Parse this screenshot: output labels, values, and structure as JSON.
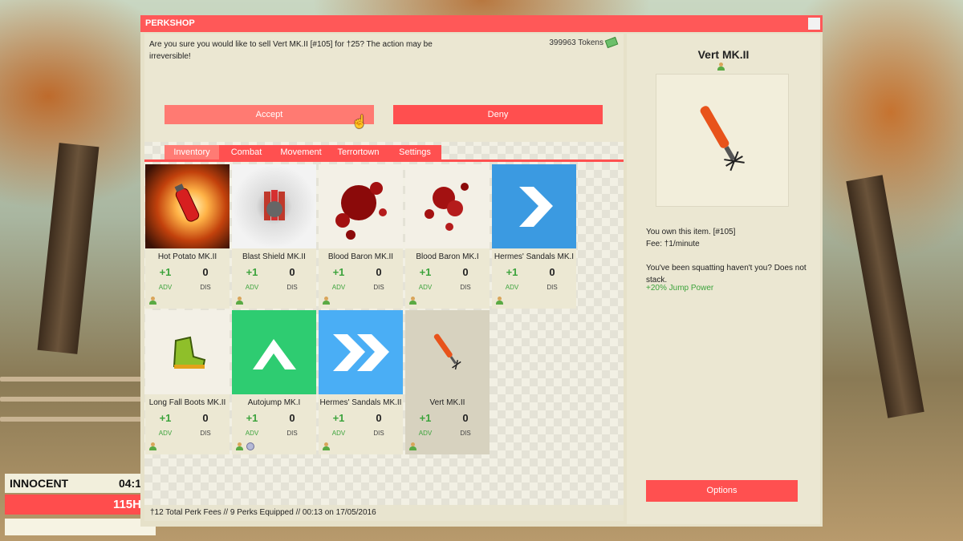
{
  "window": {
    "title": "PERKSHOP"
  },
  "confirm": {
    "message": "Are you sure you would like to sell Vert MK.II [#105] for †25? The action may be irreversible!",
    "tokens": "399963 Tokens",
    "accept_label": "Accept",
    "deny_label": "Deny"
  },
  "tabs": [
    "Inventory",
    "Combat",
    "Movement",
    "Terrortown",
    "Settings"
  ],
  "active_tab": "Inventory",
  "perks": [
    {
      "name": "Hot Potato MK.II",
      "adv": "+1",
      "dis": "0",
      "icon": "grenade-fire-icon"
    },
    {
      "name": "Blast Shield MK.II",
      "adv": "+1",
      "dis": "0",
      "icon": "dynamite-shield-icon"
    },
    {
      "name": "Blood Baron MK.II",
      "adv": "+1",
      "dis": "0",
      "icon": "blood-splatter-icon"
    },
    {
      "name": "Blood Baron MK.I",
      "adv": "+1",
      "dis": "0",
      "icon": "blood-splatter-icon"
    },
    {
      "name": "Hermes' Sandals MK.I",
      "adv": "+1",
      "dis": "0",
      "icon": "chevron-right-icon",
      "color": "#3b9ae1"
    },
    {
      "name": "Long Fall Boots MK.II",
      "adv": "+1",
      "dis": "0",
      "icon": "boot-icon"
    },
    {
      "name": "Autojump MK.I",
      "adv": "+1",
      "dis": "0",
      "icon": "chevron-up-icon",
      "color": "#2ecc71"
    },
    {
      "name": "Hermes' Sandals MK.II",
      "adv": "+1",
      "dis": "0",
      "icon": "double-chevron-right-icon",
      "color": "#4aaef5"
    },
    {
      "name": "Vert MK.II",
      "adv": "+1",
      "dis": "0",
      "icon": "rocket-icon"
    }
  ],
  "labels": {
    "adv": "ADV",
    "dis": "DIS"
  },
  "footer": "†12 Total Perk Fees // 9 Perks Equipped // 00:13 on 17/05/2016",
  "detail": {
    "title": "Vert MK.II",
    "owned": "You own this item. [#105]",
    "fee": "Fee: †1/minute",
    "description": "You've been squatting haven't you? Does not stack.",
    "effect": "+20% Jump Power",
    "options_label": "Options"
  },
  "hud": {
    "role": "INNOCENT",
    "time": "04:1",
    "hp": "115H"
  },
  "colors": {
    "accent": "#ff5050",
    "positive": "#3ca33c"
  }
}
